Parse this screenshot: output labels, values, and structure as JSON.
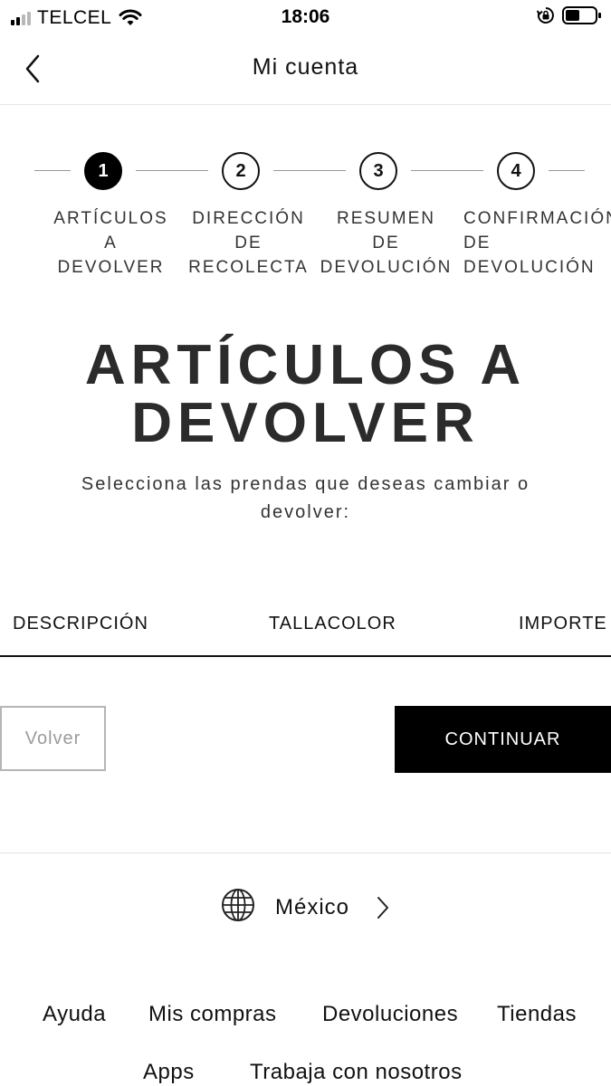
{
  "status_bar": {
    "carrier": "TELCEL",
    "time": "18:06",
    "icons": [
      "signal-icon",
      "wifi-icon",
      "rotation-lock-icon",
      "battery-icon"
    ]
  },
  "nav": {
    "back_icon": "chevron-left-icon",
    "title": "Mi cuenta"
  },
  "stepper": {
    "current_step": 1,
    "steps": [
      {
        "number": "1",
        "label": "ARTÍCULOS\nA\nDEVOLVER"
      },
      {
        "number": "2",
        "label": "DIRECCIÓN\nDE\nRECOLECTA"
      },
      {
        "number": "3",
        "label": "RESUMEN\nDE\nDEVOLUCIÓN"
      },
      {
        "number": "4",
        "label": "CONFIRMACIÓN\nDE\nDEVOLUCIÓN"
      }
    ]
  },
  "main": {
    "heading": "ARTÍCULOS A\nDEVOLVER",
    "subtitle": "Selecciona las prendas que deseas cambiar o devolver:"
  },
  "table": {
    "columns": [
      "DESCRIPCIÓN",
      "TALLACOLOR",
      "IMPORTE"
    ]
  },
  "actions": {
    "back_label": "Volver",
    "continue_label": "CONTINUAR"
  },
  "country": {
    "icon": "globe-icon",
    "name": "México",
    "chevron_icon": "chevron-right-icon"
  },
  "footer": {
    "links": [
      "Ayuda",
      "Mis compras",
      "Devoluciones",
      "Tiendas",
      "Apps",
      "Trabaja con nosotros"
    ]
  },
  "colors": {
    "primary_button_bg": "#000000",
    "active_step_bg": "#000000",
    "secondary_button_border": "#b5b5b5"
  }
}
